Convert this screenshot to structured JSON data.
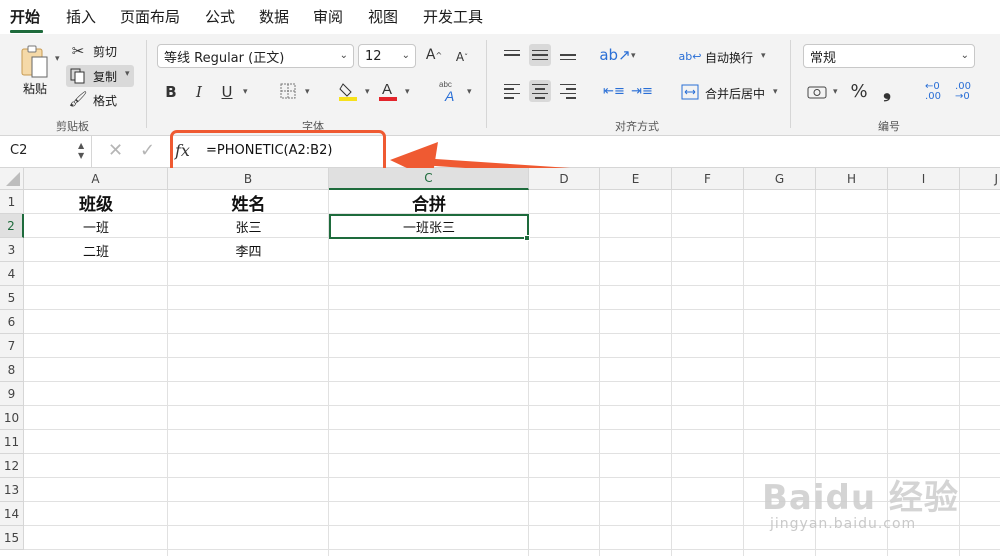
{
  "menu": {
    "tabs": [
      "开始",
      "插入",
      "页面布局",
      "公式",
      "数据",
      "审阅",
      "视图",
      "开发工具"
    ]
  },
  "ribbon": {
    "clipboard": {
      "paste": "粘贴",
      "cut": "剪切",
      "copy": "复制",
      "format_painter": "格式",
      "label": "剪贴板"
    },
    "font": {
      "name": "等线 Regular (正文)",
      "size": "12",
      "bold": "B",
      "italic": "I",
      "underline": "U",
      "label": "字体"
    },
    "alignment": {
      "wrap": "自动换行",
      "merge": "合并后居中",
      "label": "对齐方式"
    },
    "number": {
      "format": "常规",
      "percent": "%",
      "comma": "❟",
      "label": "编号"
    }
  },
  "formula_bar": {
    "name_box": "C2",
    "fx": "fx",
    "formula": "=PHONETIC(A2:B2)"
  },
  "columns": [
    "A",
    "B",
    "C",
    "D",
    "E",
    "F",
    "G",
    "H",
    "I",
    "J"
  ],
  "rows": [
    "1",
    "2",
    "3",
    "4",
    "5",
    "6",
    "7",
    "8",
    "9",
    "10",
    "11",
    "12",
    "13",
    "14",
    "15"
  ],
  "cells": {
    "A1": "班级",
    "B1": "姓名",
    "C1": "合拼",
    "A2": "一班",
    "B2": "张三",
    "C2": "一班张三",
    "A3": "二班",
    "B3": "李四"
  },
  "watermark": {
    "main": "Baidu 经验",
    "sub": "jingyan.baidu.com"
  },
  "colors": {
    "accent_green": "#1e6b3c",
    "annotation_red": "#ef5a32"
  }
}
